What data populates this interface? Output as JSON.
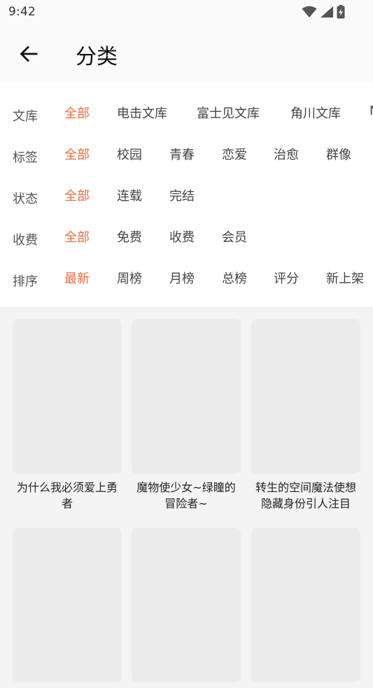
{
  "status": {
    "time": "9:42"
  },
  "header": {
    "title": "分类"
  },
  "filters": [
    {
      "label": "文库",
      "options": [
        "全部",
        "电击文库",
        "富士见文库",
        "角川文库",
        "MF"
      ],
      "active": 0
    },
    {
      "label": "标签",
      "options": [
        "全部",
        "校园",
        "青春",
        "恋爱",
        "治愈",
        "群像"
      ],
      "active": 0
    },
    {
      "label": "状态",
      "options": [
        "全部",
        "连载",
        "完结"
      ],
      "active": 0
    },
    {
      "label": "收费",
      "options": [
        "全部",
        "免费",
        "收费",
        "会员"
      ],
      "active": 0
    },
    {
      "label": "排序",
      "options": [
        "最新",
        "周榜",
        "月榜",
        "总榜",
        "评分",
        "新上架"
      ],
      "active": 0
    }
  ],
  "books": [
    {
      "title": "为什么我必须爱上勇者"
    },
    {
      "title": "魔物使少女~绿瞳的冒险者~"
    },
    {
      "title": "转生的空间魔法使想隐藏身份引人注目"
    },
    {
      "title": ""
    },
    {
      "title": ""
    },
    {
      "title": ""
    }
  ],
  "colors": {
    "accent": "#f26a3c",
    "cover_placeholder": "#ececec"
  }
}
